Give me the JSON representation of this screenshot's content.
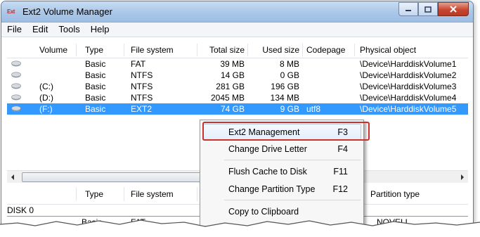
{
  "window": {
    "title": "Ext2 Volume Manager",
    "icon_text": "Ext",
    "icon": "ext2-app-icon"
  },
  "window_controls": {
    "minimize": "minimize-icon",
    "maximize": "maximize-icon",
    "close": "close-icon"
  },
  "menubar": {
    "items": [
      "File",
      "Edit",
      "Tools",
      "Help"
    ]
  },
  "volumes": {
    "columns": [
      "Volume",
      "Type",
      "File system",
      "Total size",
      "Used size",
      "Codepage",
      "Physical object"
    ],
    "rows": [
      {
        "volume": "",
        "type": "Basic",
        "fs": "FAT",
        "total": "39 MB",
        "used": "8 MB",
        "codepage": "",
        "object": "\\Device\\HarddiskVolume1"
      },
      {
        "volume": "",
        "type": "Basic",
        "fs": "NTFS",
        "total": "14 GB",
        "used": "0 GB",
        "codepage": "",
        "object": "\\Device\\HarddiskVolume2"
      },
      {
        "volume": "(C:)",
        "type": "Basic",
        "fs": "NTFS",
        "total": "281 GB",
        "used": "196 GB",
        "codepage": "",
        "object": "\\Device\\HarddiskVolume3"
      },
      {
        "volume": "(D:)",
        "type": "Basic",
        "fs": "NTFS",
        "total": "2045 MB",
        "used": "134 MB",
        "codepage": "",
        "object": "\\Device\\HarddiskVolume4"
      },
      {
        "volume": "(F:)",
        "type": "Basic",
        "fs": "EXT2",
        "total": "74 GB",
        "used": "9 GB",
        "codepage": "utf8",
        "object": "\\Device\\HarddiskVolume5"
      }
    ],
    "selected_index": 4
  },
  "disks": {
    "columns": [
      "",
      "Type",
      "File system",
      "Partition type"
    ],
    "disk_label": "DISK 0",
    "first_partition": {
      "type": "Basic",
      "fs": "FAT",
      "ptype": "NOVELL"
    }
  },
  "context_menu": {
    "items": [
      {
        "label": "Ext2 Management",
        "key": "F3"
      },
      {
        "label": "Change Drive Letter",
        "key": "F4"
      },
      {
        "label": "Flush Cache to Disk",
        "key": "F11"
      },
      {
        "label": "Change Partition Type",
        "key": "F12"
      },
      {
        "label": "Copy to Clipboard",
        "key": ""
      }
    ],
    "highlighted_index": 0
  },
  "colors": {
    "selection": "#3399ff",
    "callout": "#c8312c",
    "titlebar": "#aac7e8"
  }
}
